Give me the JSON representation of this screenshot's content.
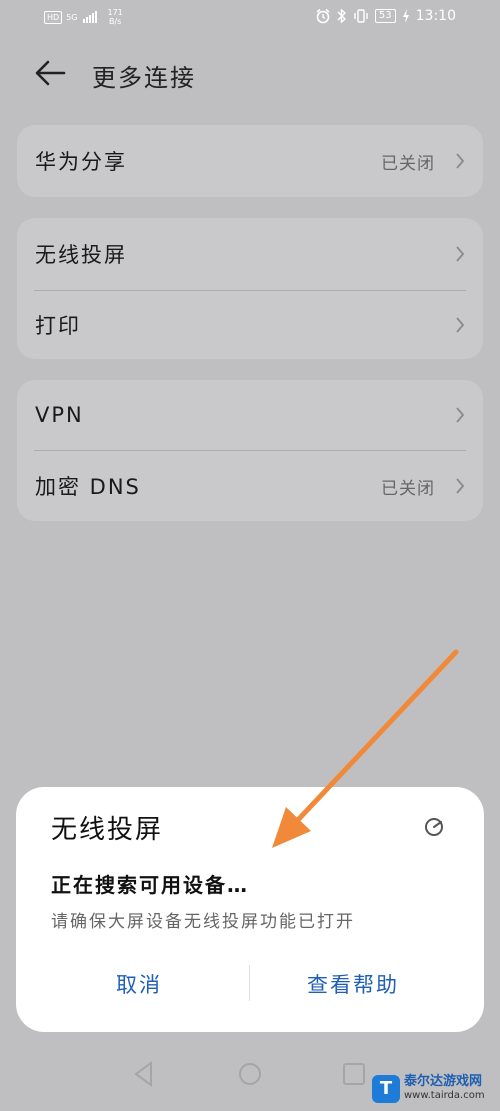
{
  "status_bar": {
    "hd_badge": "HD",
    "network": "5G",
    "speed_value": "171",
    "speed_unit": "B/s",
    "battery": "53",
    "time": "13:10",
    "icons": [
      "alarm-icon",
      "bluetooth-icon",
      "vibrate-icon",
      "battery-icon",
      "charging-icon"
    ]
  },
  "header": {
    "title": "更多连接"
  },
  "sections": {
    "huawei_share": {
      "label": "华为分享",
      "value": "已关闭"
    },
    "wireless_projection": {
      "label": "无线投屏"
    },
    "print": {
      "label": "打印"
    },
    "vpn": {
      "label": "VPN"
    },
    "private_dns": {
      "label": "加密 DNS",
      "value": "已关闭"
    }
  },
  "dialog": {
    "title": "无线投屏",
    "message": "正在搜索可用设备…",
    "hint": "请确保大屏设备无线投屏功能已打开",
    "cancel_label": "取消",
    "help_label": "查看帮助"
  },
  "watermark": {
    "logo": "T",
    "name": "泰尔达游戏网",
    "url": "www.tairda.com"
  },
  "colors": {
    "background": "#bfbfc2",
    "card": "#c9c9cc",
    "dialog_button": "#1f5fb8",
    "annotation_arrow": "#f08a3a"
  }
}
